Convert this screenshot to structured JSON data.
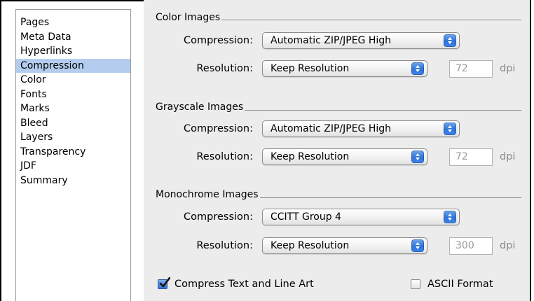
{
  "sidebar": {
    "items": [
      {
        "label": "Pages",
        "selected": false
      },
      {
        "label": "Meta Data",
        "selected": false
      },
      {
        "label": "Hyperlinks",
        "selected": false
      },
      {
        "label": "Compression",
        "selected": true
      },
      {
        "label": "Color",
        "selected": false
      },
      {
        "label": "Fonts",
        "selected": false
      },
      {
        "label": "Marks",
        "selected": false
      },
      {
        "label": "Bleed",
        "selected": false
      },
      {
        "label": "Layers",
        "selected": false
      },
      {
        "label": "Transparency",
        "selected": false
      },
      {
        "label": "JDF",
        "selected": false
      },
      {
        "label": "Summary",
        "selected": false
      }
    ]
  },
  "color_images": {
    "title": "Color Images",
    "compression_label": "Compression:",
    "compression_value": "Automatic ZIP/JPEG High",
    "resolution_label": "Resolution:",
    "resolution_value": "Keep Resolution",
    "dpi_value": "72",
    "dpi_unit": "dpi"
  },
  "grayscale_images": {
    "title": "Grayscale Images",
    "compression_label": "Compression:",
    "compression_value": "Automatic ZIP/JPEG High",
    "resolution_label": "Resolution:",
    "resolution_value": "Keep Resolution",
    "dpi_value": "72",
    "dpi_unit": "dpi"
  },
  "monochrome_images": {
    "title": "Monochrome Images",
    "compression_label": "Compression:",
    "compression_value": "CCITT Group 4",
    "resolution_label": "Resolution:",
    "resolution_value": "Keep Resolution",
    "dpi_value": "300",
    "dpi_unit": "dpi"
  },
  "options": {
    "compress_text": {
      "label": "Compress Text and Line Art",
      "checked": true
    },
    "ascii_format": {
      "label": "ASCII Format",
      "checked": false
    }
  },
  "colors": {
    "selection": "#b4cdee",
    "accent": "#2f73d8",
    "panel_bg": "#ececec"
  }
}
